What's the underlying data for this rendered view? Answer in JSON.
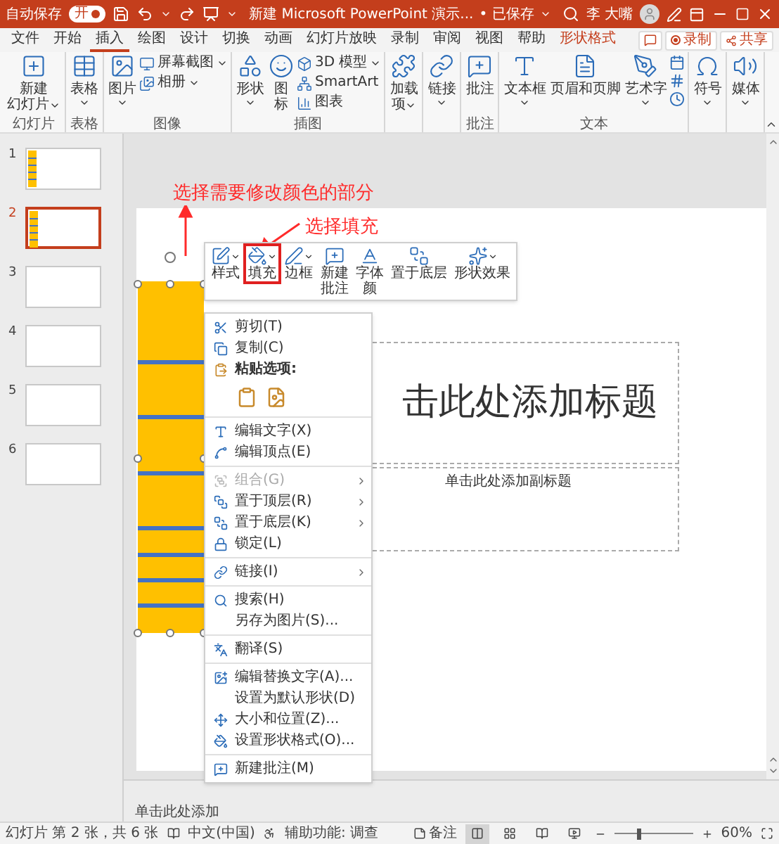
{
  "title_bar": {
    "autosave_label": "自动保存",
    "autosave_toggle": {
      "label": "开",
      "on": true
    },
    "document_title": "新建 Microsoft PowerPoint 演示...",
    "save_status": "• 已保存",
    "user_name": "李 大嘴"
  },
  "tabs": [
    {
      "label": "文件",
      "selected": false,
      "kind": "normal"
    },
    {
      "label": "开始",
      "selected": false,
      "kind": "normal"
    },
    {
      "label": "插入",
      "selected": true,
      "kind": "normal"
    },
    {
      "label": "绘图",
      "selected": false,
      "kind": "normal"
    },
    {
      "label": "设计",
      "selected": false,
      "kind": "normal"
    },
    {
      "label": "切换",
      "selected": false,
      "kind": "normal"
    },
    {
      "label": "动画",
      "selected": false,
      "kind": "normal"
    },
    {
      "label": "幻灯片放映",
      "selected": false,
      "kind": "normal"
    },
    {
      "label": "录制",
      "selected": false,
      "kind": "normal"
    },
    {
      "label": "审阅",
      "selected": false,
      "kind": "normal"
    },
    {
      "label": "视图",
      "selected": false,
      "kind": "normal"
    },
    {
      "label": "帮助",
      "selected": false,
      "kind": "normal"
    },
    {
      "label": "形状格式",
      "selected": false,
      "kind": "contextual"
    }
  ],
  "actions": [
    {
      "kind": "comments"
    },
    {
      "kind": "record",
      "label": "录制"
    },
    {
      "kind": "share",
      "label": "共享"
    }
  ],
  "ribbon_groups": [
    {
      "label": "幻灯片",
      "items": [
        {
          "kind": "large",
          "lines": [
            "新建",
            "幻灯片"
          ],
          "dropdown": true
        }
      ]
    },
    {
      "label": "表格",
      "items": [
        {
          "kind": "large",
          "lines": [
            "表格"
          ],
          "dropdown": true
        }
      ]
    },
    {
      "label": "图像",
      "items": [
        {
          "kind": "large",
          "lines": [
            "图片"
          ],
          "dropdown": true
        },
        {
          "kind": "small",
          "label": "屏幕截图",
          "dropdown": true
        },
        {
          "kind": "small",
          "label": "相册",
          "dropdown": true
        }
      ]
    },
    {
      "label": "插图",
      "items": [
        {
          "kind": "large",
          "lines": [
            "形状"
          ],
          "dropdown": true
        },
        {
          "kind": "large",
          "lines": [
            "图",
            "标"
          ],
          "dropdown": false
        },
        {
          "kind": "small",
          "label": "3D 模型",
          "dropdown": true
        },
        {
          "kind": "small",
          "label": "SmartArt",
          "dropdown": false
        },
        {
          "kind": "small",
          "label": "图表",
          "dropdown": false
        }
      ]
    },
    {
      "items": [
        {
          "kind": "large",
          "lines": [
            "加载",
            "项"
          ],
          "dropdown": true
        }
      ]
    },
    {
      "items": [
        {
          "kind": "large",
          "lines": [
            "链接"
          ],
          "dropdown": true
        }
      ]
    },
    {
      "label": "批注",
      "items": [
        {
          "kind": "large",
          "lines": [
            "批注"
          ],
          "dropdown": false
        }
      ]
    },
    {
      "label": "文本",
      "items": [
        {
          "kind": "large",
          "lines": [
            "文本框"
          ],
          "dropdown": true
        },
        {
          "kind": "large",
          "lines": [
            "页眉和页脚"
          ],
          "dropdown": false
        },
        {
          "kind": "large",
          "lines": [
            "艺术字"
          ],
          "dropdown": true
        },
        {
          "kind": "icon_stack"
        }
      ]
    },
    {
      "items": [
        {
          "kind": "large",
          "lines": [
            "符号"
          ],
          "dropdown": true
        }
      ]
    },
    {
      "items": [
        {
          "kind": "large",
          "lines": [
            "媒体"
          ],
          "dropdown": true
        }
      ]
    }
  ],
  "slides": [
    {
      "number": "1",
      "selected": false,
      "has_shape": true
    },
    {
      "number": "2",
      "selected": true,
      "has_shape": true
    },
    {
      "number": "3",
      "selected": false,
      "has_shape": false
    },
    {
      "number": "4",
      "selected": false,
      "has_shape": false
    },
    {
      "number": "5",
      "selected": false,
      "has_shape": false
    },
    {
      "number": "6",
      "selected": false,
      "has_shape": false
    }
  ],
  "slide": {
    "shape": {
      "selected": true
    },
    "title_placeholder": "击此处添加标题",
    "subtitle_placeholder": "单击此处添加副标题"
  },
  "annotations": [
    {
      "text": "选择需要修改颜色的部分"
    },
    {
      "text": "选择填充"
    }
  ],
  "mini_toolbar": [
    {
      "lines": [
        "样式"
      ],
      "dropdown": true,
      "highlighted": false
    },
    {
      "lines": [
        "填充"
      ],
      "dropdown": true,
      "highlighted": true
    },
    {
      "lines": [
        "边框"
      ],
      "dropdown": true,
      "highlighted": false
    },
    {
      "lines": [
        "新建",
        "批注"
      ],
      "dropdown": false,
      "highlighted": false
    },
    {
      "lines": [
        "字体",
        "颜"
      ],
      "dropdown": false,
      "highlighted": false
    },
    {
      "lines": [
        "置于底层"
      ],
      "dropdown": false,
      "highlighted": false
    },
    {
      "lines": [
        "形状效果"
      ],
      "dropdown": true,
      "highlighted": false
    }
  ],
  "context_menu": [
    {
      "kind": "item",
      "label": "剪切(T)",
      "disabled": false,
      "submenu": false
    },
    {
      "kind": "item",
      "label": "复制(C)",
      "disabled": false,
      "submenu": false
    },
    {
      "kind": "header",
      "label": "粘贴选项:"
    },
    {
      "kind": "paste_options"
    },
    {
      "kind": "separator"
    },
    {
      "kind": "item",
      "label": "编辑文字(X)",
      "disabled": false,
      "submenu": false
    },
    {
      "kind": "item",
      "label": "编辑顶点(E)",
      "disabled": false,
      "submenu": false
    },
    {
      "kind": "separator"
    },
    {
      "kind": "item",
      "label": "组合(G)",
      "disabled": true,
      "submenu": true
    },
    {
      "kind": "item",
      "label": "置于顶层(R)",
      "disabled": false,
      "submenu": true
    },
    {
      "kind": "item",
      "label": "置于底层(K)",
      "disabled": false,
      "submenu": true
    },
    {
      "kind": "item",
      "label": "锁定(L)",
      "disabled": false,
      "submenu": false
    },
    {
      "kind": "separator"
    },
    {
      "kind": "item",
      "label": "链接(I)",
      "disabled": false,
      "submenu": true
    },
    {
      "kind": "separator"
    },
    {
      "kind": "item",
      "label": "搜索(H)",
      "disabled": false,
      "submenu": false
    },
    {
      "kind": "item",
      "label": "另存为图片(S)...",
      "disabled": false,
      "submenu": false
    },
    {
      "kind": "separator"
    },
    {
      "kind": "item",
      "label": "翻译(S)",
      "disabled": false,
      "submenu": false
    },
    {
      "kind": "separator"
    },
    {
      "kind": "item",
      "label": "编辑替换文字(A)...",
      "disabled": false,
      "submenu": false
    },
    {
      "kind": "item",
      "label": "设置为默认形状(D)",
      "disabled": false,
      "submenu": false
    },
    {
      "kind": "item",
      "label": "大小和位置(Z)...",
      "disabled": false,
      "submenu": false
    },
    {
      "kind": "item",
      "label": "设置形状格式(O)...",
      "disabled": false,
      "submenu": false
    },
    {
      "kind": "separator"
    },
    {
      "kind": "item",
      "label": "新建批注(M)",
      "disabled": false,
      "submenu": false
    }
  ],
  "notes": {
    "placeholder": "单击此处添加"
  },
  "status_bar": {
    "slide_info": "幻灯片 第 2 张，共 6 张",
    "language": "中文(中国)",
    "accessibility": "辅助功能: 调查",
    "notes_button": "备注",
    "views": [
      {
        "selected": true
      },
      {
        "selected": false
      },
      {
        "selected": false
      },
      {
        "selected": false
      }
    ],
    "zoom": {
      "level": 0.3
    },
    "zoom_percent": "60%"
  }
}
